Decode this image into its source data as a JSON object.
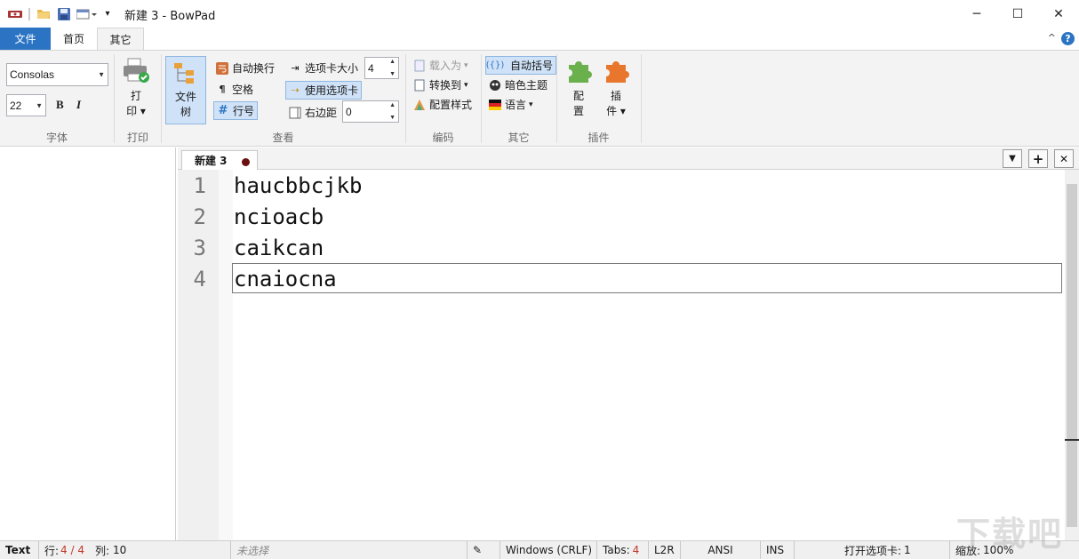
{
  "window": {
    "title": "新建 3 - BowPad",
    "minimize_label": "─",
    "maximize_label": "☐",
    "close_label": "✕"
  },
  "ribbon_tabs": [
    {
      "label": "文件"
    },
    {
      "label": "首页"
    },
    {
      "label": "其它"
    }
  ],
  "ribbon": {
    "font_group": {
      "label": "字体",
      "font_name": "Consolas",
      "font_size": "22",
      "bold_label": "B",
      "italic_label": "I"
    },
    "print_group": {
      "label": "打印",
      "print_label_1": "打",
      "print_label_2": "印"
    },
    "view_group": {
      "label": "查看",
      "file_tree_1": "文件",
      "file_tree_2": "树",
      "word_wrap": "自动换行",
      "whitespace": "空格",
      "line_numbers": "行号",
      "tab_size_label": "选项卡大小",
      "tab_size_value": "4",
      "use_tabs": "使用选项卡",
      "right_margin_label": "右边距",
      "right_margin_value": "0"
    },
    "encoding_group": {
      "label": "编码",
      "load_as": "载入为",
      "convert_to": "转换到",
      "config_style": "配置样式"
    },
    "other_group": {
      "label": "其它",
      "auto_brace": "自动括号",
      "dark_theme": "暗色主题",
      "language": "语言"
    },
    "plugins_group": {
      "label": "插件",
      "config_1": "配",
      "config_2": "置",
      "plugins_1": "插",
      "plugins_2": "件"
    }
  },
  "document": {
    "tab_label": "新建 3",
    "line_numbers": [
      "1",
      "2",
      "3",
      "4"
    ],
    "lines": [
      "haucbbcjkb",
      "ncioacb",
      "caikcan",
      "cnaiocna"
    ]
  },
  "tabstrip_buttons": {
    "list": "▼",
    "add": "+",
    "close": "✕"
  },
  "statusbar": {
    "lexer": "Text",
    "row_label": "行:",
    "row_value": "4 / 4",
    "col_label": "列:",
    "col_value": "10",
    "selection": "未选择",
    "line_ending": "Windows (CRLF)",
    "tabs_label": "Tabs:",
    "tabs_value": "4",
    "direction": "L2R",
    "encoding": "ANSI",
    "insert_mode": "INS",
    "open_tabs_label": "打开选项卡:",
    "open_tabs_value": "1",
    "zoom_label": "缩放:",
    "zoom_value": "100%"
  },
  "colors": {
    "accent": "#2b74c4",
    "ribbon_bg": "#f3f3f3",
    "active_button": "#cfe2f7",
    "modified_dot": "#6a1010"
  }
}
